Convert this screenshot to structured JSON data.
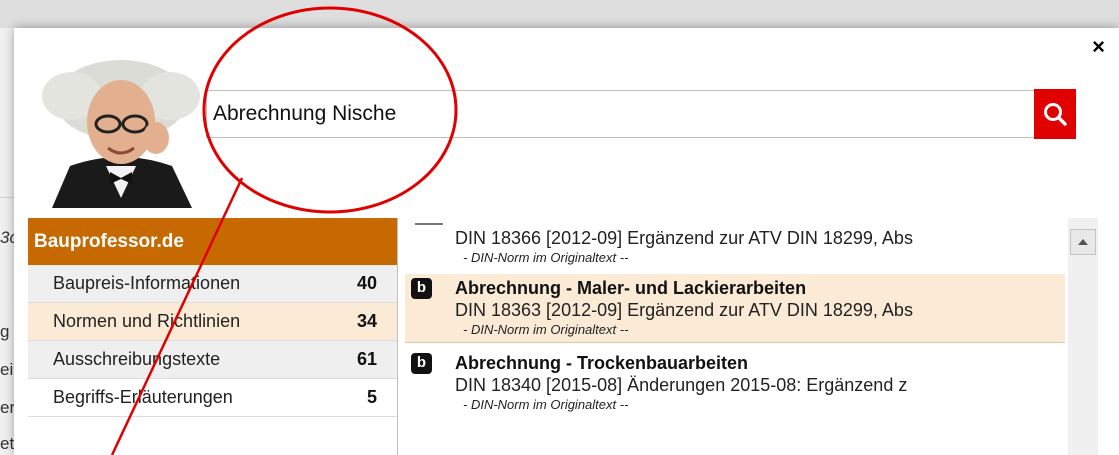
{
  "background_page": {
    "fragments": [
      "3c",
      "g",
      "ei",
      "er",
      "et"
    ]
  },
  "popup": {
    "close_glyph": "×",
    "search": {
      "value": "Abrechnung Nische",
      "button_icon": "search-icon"
    },
    "categories": {
      "header": "Bauprofessor.de",
      "items": [
        {
          "label": "Baupreis-Informationen",
          "count": "40"
        },
        {
          "label": "Normen und Richtlinien",
          "count": "34",
          "active": true
        },
        {
          "label": "Ausschreibungstexte",
          "count": "61"
        },
        {
          "label": "Begriffs-Erläuterungen",
          "count": "5"
        }
      ]
    },
    "results": [
      {
        "title": "",
        "line": "DIN 18366 [2012-09]  Ergänzend zur ATV DIN 18299, Abs",
        "sub": "- DIN-Norm im Originaltext --"
      },
      {
        "icon_letter": "b",
        "title": "Abrechnung - Maler- und Lackierarbeiten",
        "line": "DIN 18363 [2012-09]  Ergänzend zur ATV DIN 18299, Abs",
        "sub": "- DIN-Norm im Originaltext --"
      },
      {
        "icon_letter": "b",
        "title": "Abrechnung - Trockenbauarbeiten",
        "line": "DIN 18340 [2015-08]  Änderungen 2015-08: Ergänzend z",
        "sub": "- DIN-Norm im Originaltext --"
      }
    ]
  },
  "colors": {
    "accent_orange": "#c66900",
    "highlight_row": "#fbead6",
    "search_button": "#e10000",
    "annotation_red": "#e00000"
  }
}
